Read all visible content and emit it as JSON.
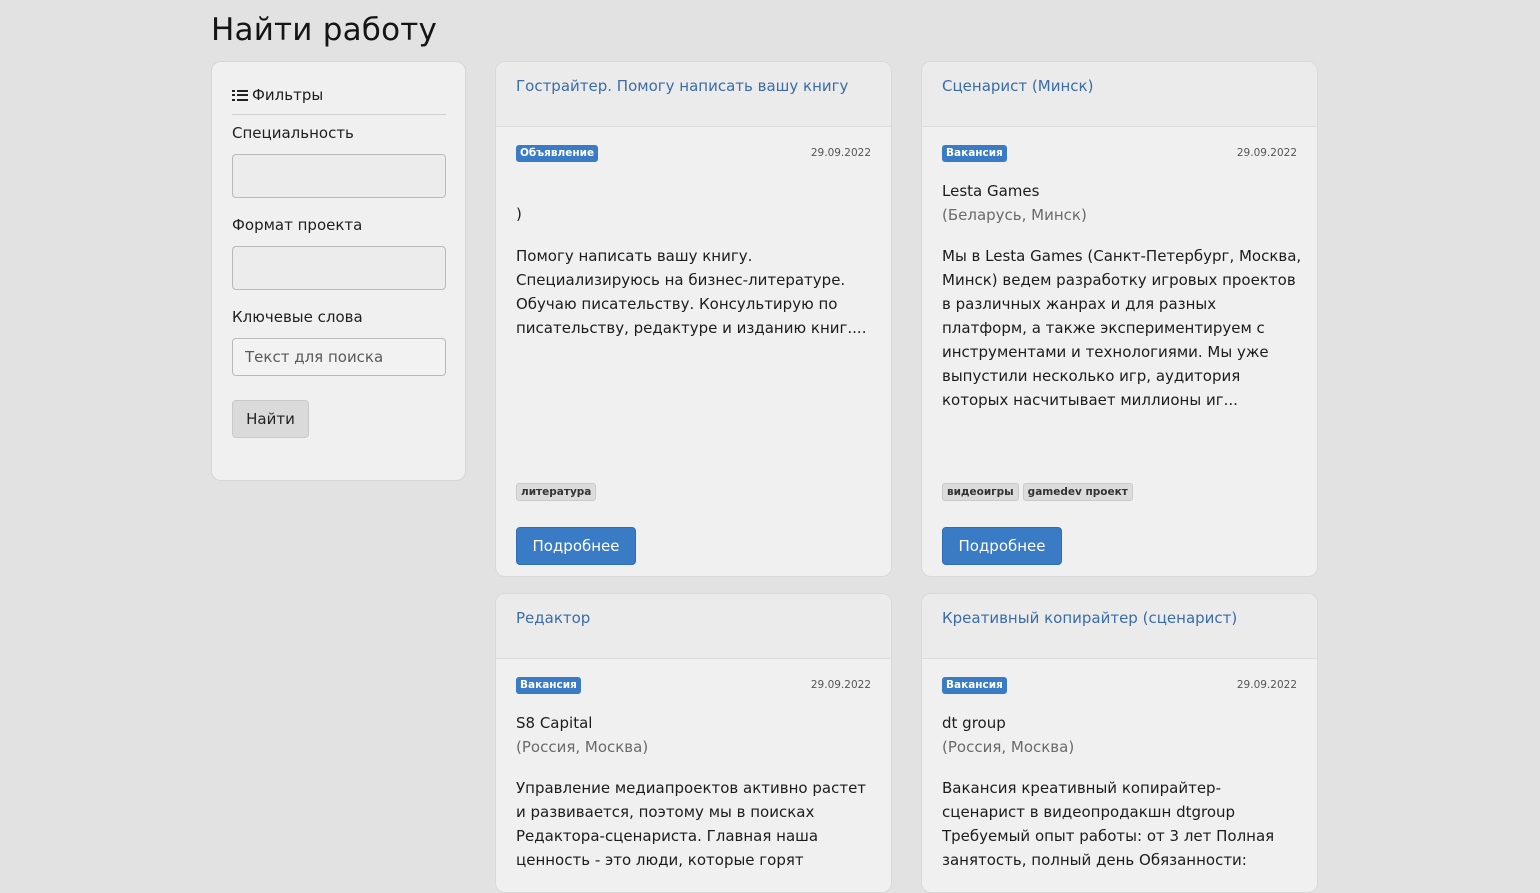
{
  "page_title": "Найти работу",
  "filters": {
    "heading": "Фильтры",
    "heading_icon": "list-icon",
    "specialty_label": "Специальность",
    "specialty_value": "",
    "format_label": "Формат проекта",
    "format_value": "",
    "keywords_label": "Ключевые слова",
    "keywords_placeholder": "Текст для поиска",
    "search_button": "Найти"
  },
  "accent_color": "#3a7bc6",
  "more_label": "Подробнее",
  "cards": [
    {
      "title": "Гострайтер. Помогу написать вашу книгу",
      "badge": "Объявление",
      "date": "29.09.2022",
      "company": ")",
      "location": "",
      "description": "Помогу написать вашу книгу. Специализируюсь на бизнес-литературе. Обучаю писательству. Консультирую по писательству, редактуре и изданию книг....",
      "tags": [
        "литература"
      ]
    },
    {
      "title": "Сценарист (Минск)",
      "badge": "Вакансия",
      "date": "29.09.2022",
      "company": "Lesta Games",
      "location": "(Беларусь, Минск)",
      "description": "Мы в Lesta Games (Санкт-Петербург, Москва, Минск) ведем разработку игровых проектов в различных жанрах и для разных платформ, а также экспериментируем с инструментами и технологиями. Мы уже выпустили несколько игр, аудитория которых насчитывает миллионы иг...",
      "tags": [
        "видеоигры",
        "gamedev проект"
      ]
    },
    {
      "title": "Редактор",
      "badge": "Вакансия",
      "date": "29.09.2022",
      "company": "S8 Capital",
      "location": "(Россия, Москва)",
      "description": "Управление медиапроектов активно растет и развивается, поэтому мы в поисках Редактора-сценариста. Главная наша ценность - это люди, которые горят",
      "tags": []
    },
    {
      "title": "Креативный копирайтер (сценарист)",
      "badge": "Вакансия",
      "date": "29.09.2022",
      "company": "dt group",
      "location": "(Россия, Москва)",
      "description": "Вакансия креативный копирайтер-сценарист в видеопродакшн dtgroup Требуемый опыт работы: от 3 лет Полная занятость, полный день Обязанности:",
      "tags": []
    }
  ]
}
